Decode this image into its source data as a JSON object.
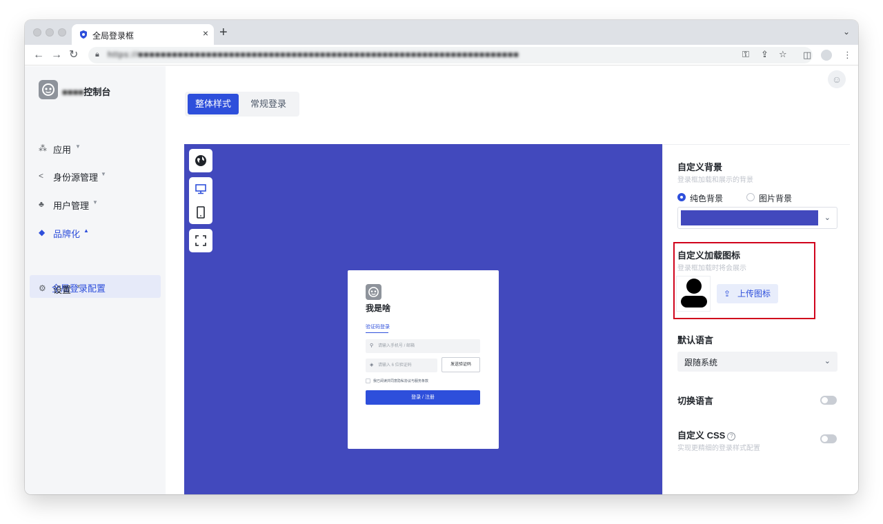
{
  "browser": {
    "tab_title": "全局登录框",
    "url": "https://■■■■■■■■■■■■■■■■■■■■■■■■■■■■■■■■■■■■■■■■■■■■■■■■■■■■■■■■■■■■■■■■■■■",
    "new_tab": "+",
    "tab_close": "×"
  },
  "sidebar": {
    "brand_blurred": "■■■■",
    "brand_suffix": "控制台",
    "items": [
      {
        "label": "应用",
        "icon": "apps-icon"
      },
      {
        "label": "身份源管理",
        "icon": "share-icon"
      },
      {
        "label": "用户管理",
        "icon": "org-icon"
      },
      {
        "label": "品牌化",
        "icon": "brand-icon",
        "active": true
      },
      {
        "label": "设置",
        "icon": "gear-icon"
      }
    ],
    "submenu_active": "全局登录配置"
  },
  "main": {
    "tabs": [
      "整体样式",
      "常规登录"
    ],
    "active_tab": "整体样式"
  },
  "preview": {
    "card": {
      "title": "我是啥",
      "tab": "验证码登录",
      "phone_placeholder": "请输入手机号 / 邮箱",
      "code_placeholder": "请输入 6 位验证码",
      "send_code": "发送验证码",
      "agree": "我已阅读并同意隐私协议与服务条款",
      "submit": "登录 / 注册"
    }
  },
  "settings": {
    "background": {
      "title": "自定义背景",
      "desc": "登录框加载和展示的背景",
      "options": [
        "纯色背景",
        "图片背景"
      ],
      "selected": "纯色背景",
      "color": "#4249bd"
    },
    "loading_icon": {
      "title": "自定义加载图标",
      "desc": "登录框加载时将会展示",
      "upload_label": "上传图标"
    },
    "language": {
      "title": "默认语言",
      "value": "跟随系统"
    },
    "switch_language": {
      "title": "切换语言",
      "enabled": false
    },
    "custom_css": {
      "title": "自定义 CSS",
      "help": "?",
      "desc": "实现更精细的登录样式配置",
      "enabled": false
    }
  },
  "colors": {
    "accent": "#2e4fdb",
    "preview_bg": "#4249bd",
    "highlight": "#d0021b"
  }
}
